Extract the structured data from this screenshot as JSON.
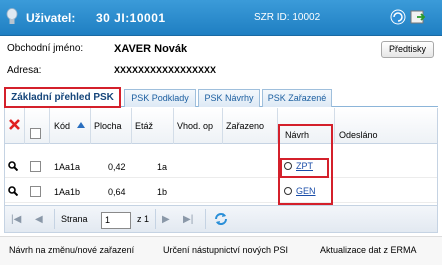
{
  "header": {
    "user_label": "Uživatel:",
    "user_value": "30 JI:10001",
    "szr_label": "SZR ID:",
    "szr_value": "10002"
  },
  "info": {
    "name_label": "Obchodní jméno:",
    "name_value": "XAVER Novák",
    "address_label": "Adresa:",
    "address_value": "XXXXXXXXXXXXXXXXX",
    "print_button": "Předtisky"
  },
  "tabs": [
    {
      "label": "Základní přehled PSK",
      "active": true
    },
    {
      "label": "PSK Podklady",
      "active": false
    },
    {
      "label": "PSK Návrhy",
      "active": false
    },
    {
      "label": "PSK Zařazené",
      "active": false
    }
  ],
  "grid": {
    "columns": [
      "Kód",
      "Plocha",
      "Etáž",
      "Vhod. op",
      "Zařazeno",
      "Návrh",
      "Odesláno"
    ],
    "rows": [
      {
        "kod": "1Aa1a",
        "plocha": "0,42",
        "etaz": "1a",
        "navrh": "ZPT"
      },
      {
        "kod": "1Aa1b",
        "plocha": "0,64",
        "etaz": "1b",
        "navrh": "GEN"
      }
    ]
  },
  "pager": {
    "page_label": "Strana",
    "page_value": "1",
    "of_label": "z 1"
  },
  "actions": {
    "propose_change": "Návrh na změnu/nové zařazení",
    "determine_successors": "Určení nástupnictví nových PSI",
    "update_erma": "Aktualizace dat z ERMA"
  },
  "colors": {
    "title_bar": "#1f7fc2",
    "highlight": "#d4202b",
    "tab_text": "#1c5fa0"
  }
}
